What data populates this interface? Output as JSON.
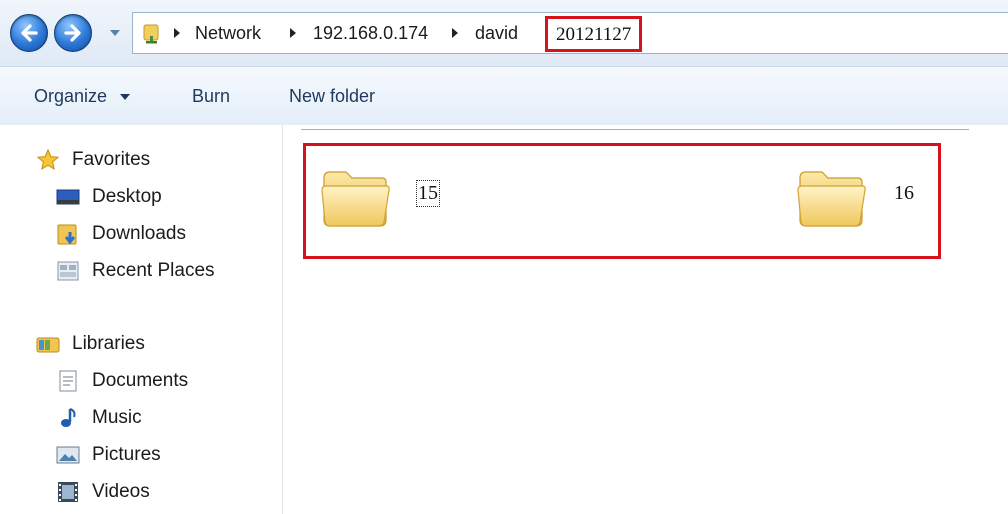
{
  "address_bar": {
    "crumbs": [
      "Network",
      "192.168.0.174",
      "david"
    ],
    "current": "20121127"
  },
  "toolbar": {
    "organize": "Organize",
    "burn": "Burn",
    "new_folder": "New folder"
  },
  "nav": {
    "favorites": {
      "label": "Favorites",
      "items": [
        "Desktop",
        "Downloads",
        "Recent Places"
      ]
    },
    "libraries": {
      "label": "Libraries",
      "items": [
        "Documents",
        "Music",
        "Pictures",
        "Videos"
      ]
    }
  },
  "folders": [
    {
      "name": "15",
      "selected": true
    },
    {
      "name": "16",
      "selected": false
    }
  ],
  "colors": {
    "highlight_red": "#d8121a",
    "nav_blue": "#2c78d6"
  }
}
